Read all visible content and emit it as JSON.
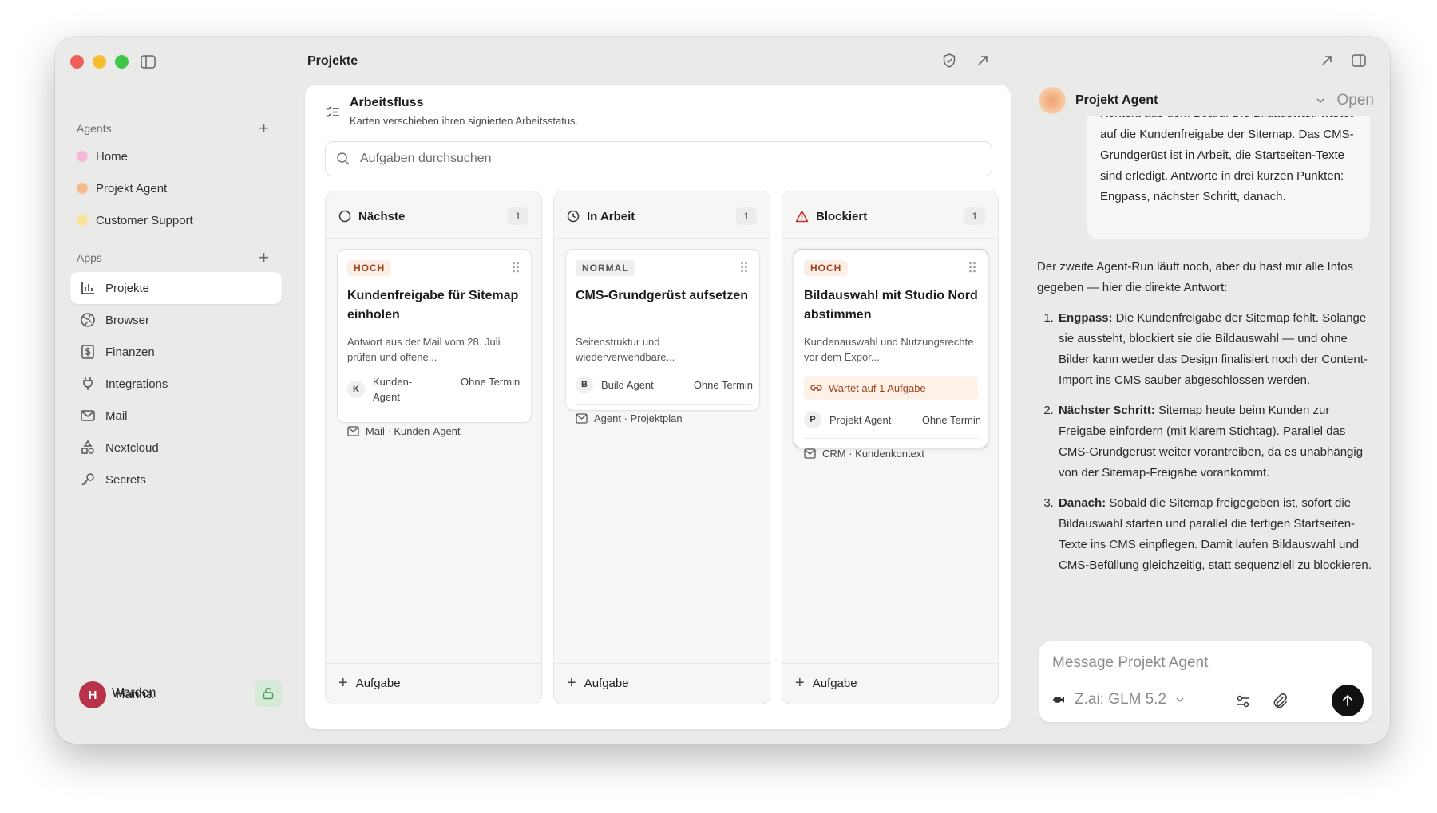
{
  "window": {
    "page_title": "Projekte"
  },
  "sidebar": {
    "agents_header": "Agents",
    "agents": [
      {
        "label": "Home",
        "color": "#f6b7d9"
      },
      {
        "label": "Projekt Agent",
        "color": "#f5b98a"
      },
      {
        "label": "Customer Support",
        "color": "#f7e29a"
      }
    ],
    "apps_header": "Apps",
    "apps": [
      {
        "label": "Projekte",
        "icon": "bar-chart-icon",
        "active": true
      },
      {
        "label": "Browser",
        "icon": "globe-icon"
      },
      {
        "label": "Finanzen",
        "icon": "dollar-icon"
      },
      {
        "label": "Integrations",
        "icon": "plug-icon"
      },
      {
        "label": "Mail",
        "icon": "mail-icon"
      },
      {
        "label": "Nextcloud",
        "icon": "shapes-icon"
      },
      {
        "label": "Secrets",
        "icon": "key-icon"
      }
    ],
    "warden_label": "Warden",
    "user": {
      "initial": "H",
      "name": "Hanna"
    }
  },
  "board": {
    "title": "Arbeitsfluss",
    "subtitle": "Karten verschieben ihren signierten Arbeitsstatus.",
    "search_placeholder": "Aufgaben durchsuchen",
    "add_task_label": "Aufgabe",
    "columns": [
      {
        "title": "Nächste",
        "count": "1",
        "icon": "circle-icon",
        "card": {
          "priority": "HOCH",
          "title": "Kundenfreigabe für Sitemap einholen",
          "description": "Antwort aus der Mail vom 28. Juli prüfen und offene...",
          "assignee_initial": "K",
          "assignee": "Kunden-Agent",
          "due": "Ohne Termin",
          "source": "Mail · Kunden-Agent"
        }
      },
      {
        "title": "In Arbeit",
        "count": "1",
        "icon": "clock-icon",
        "card": {
          "priority": "NORMAL",
          "title": "CMS-Grundgerüst aufsetzen",
          "description": "Seitenstruktur und wiederverwendbare...",
          "assignee_initial": "B",
          "assignee": "Build Agent",
          "due": "Ohne Termin",
          "source": "Agent · Projektplan"
        }
      },
      {
        "title": "Blockiert",
        "count": "1",
        "icon": "warning-icon",
        "card": {
          "priority": "HOCH",
          "title": "Bildauswahl mit Studio Nord abstimmen",
          "description": "Kundenauswahl und Nutzungsrechte vor dem Expor...",
          "waiting": "Wartet auf 1 Aufgabe",
          "assignee_initial": "P",
          "assignee": "Projekt Agent",
          "due": "Ohne Termin",
          "source": "CRM · Kundenkontext"
        }
      }
    ]
  },
  "chat": {
    "agent_name": "Projekt Agent",
    "open_label": "Open",
    "user_message": "Kontext aus dem Board: Die Bildauswahl wartet auf die Kundenfreigabe der Sitemap. Das CMS-Grundgerüst ist in Arbeit, die Startseiten-Texte sind erledigt. Antworte in drei kurzen Punkten: Engpass, nächster Schritt, danach.",
    "reply_intro": "Der zweite Agent-Run läuft noch, aber du hast mir alle Infos gegeben — hier die direkte Antwort:",
    "reply_points": [
      {
        "label": "Engpass:",
        "text": " Die Kundenfreigabe der Sitemap fehlt. Solange sie aussteht, blockiert sie die Bildauswahl — und ohne Bilder kann weder das Design finalisiert noch der Content-Import ins CMS sauber abgeschlossen werden."
      },
      {
        "label": "Nächster Schritt:",
        "text": " Sitemap heute beim Kunden zur Freigabe einfordern (mit klarem Stichtag). Parallel das CMS-Grundgerüst weiter vorantreiben, da es unabhängig von der Sitemap-Freigabe vorankommt."
      },
      {
        "label": "Danach:",
        "text": " Sobald die Sitemap freigegeben ist, sofort die Bildauswahl starten und parallel die fertigen Startseiten-Texte ins CMS einpflegen. Damit laufen Bildauswahl und CMS-Befüllung gleichzeitig, statt sequenziell zu blockieren."
      }
    ],
    "composer_placeholder": "Message Projekt Agent",
    "model_label": "Z.ai: GLM 5.2"
  }
}
